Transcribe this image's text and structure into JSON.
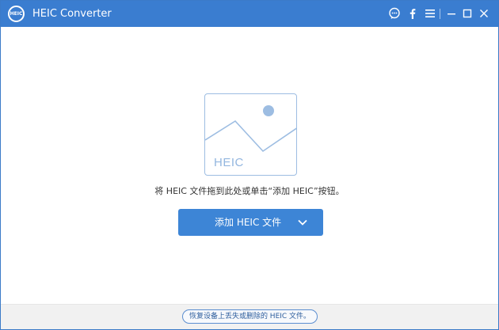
{
  "window": {
    "title": "HEIC Converter",
    "logo_text": "HEIC"
  },
  "drop_zone": {
    "image_label": "HEIC",
    "hint": "将 HEIC 文件拖到此处或单击“添加 HEIC”按钮。"
  },
  "add_button": {
    "label": "添加 HEIC 文件"
  },
  "footer": {
    "recover_link": "恢复设备上丢失或删除的 HEIC 文件。"
  },
  "icons": {
    "titlebar": [
      "feedback-icon",
      "facebook-icon",
      "menu-icon",
      "minimize-icon",
      "maximize-icon",
      "close-icon"
    ],
    "add_button": "chevron-down-icon"
  },
  "colors": {
    "titlebar": "#3a7dd0",
    "accent": "#3d85d6",
    "placeholder_stroke": "#9dbde2",
    "footer": "#f1f1f1"
  }
}
